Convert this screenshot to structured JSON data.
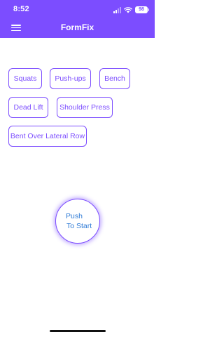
{
  "colors": {
    "accent": "#7c4dff",
    "link": "#2f7bd6"
  },
  "status_bar": {
    "time": "8:52",
    "battery": "98"
  },
  "header": {
    "title": "FormFix",
    "menu_icon": "hamburger-menu-icon"
  },
  "exercises": [
    {
      "label": "Squats"
    },
    {
      "label": "Push-ups"
    },
    {
      "label": "Bench"
    },
    {
      "label": "Dead Lift"
    },
    {
      "label": "Shoulder Press"
    },
    {
      "label": "Bent Over Lateral Row"
    }
  ],
  "start_button": {
    "line1": "Push",
    "line2": "To Start"
  }
}
